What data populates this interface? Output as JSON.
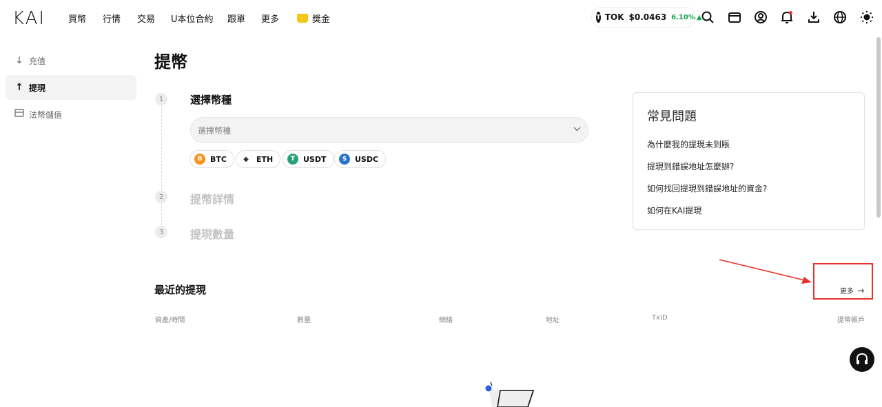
{
  "header": {
    "logo": "KAI",
    "nav": [
      "買幣",
      "行情",
      "交易",
      "U本位合約",
      "跟單",
      "更多"
    ],
    "rewards_label": "獎金",
    "ticker": {
      "symbol": "TOK",
      "price": "$0.0463",
      "change": "6.10%",
      "icon_letter": "T"
    }
  },
  "sidebar": {
    "items": [
      {
        "label": "充值",
        "icon": "arrow-down-icon",
        "active": false
      },
      {
        "label": "提現",
        "icon": "arrow-up-icon",
        "active": true
      },
      {
        "label": "法幣儲值",
        "icon": "card-icon",
        "active": false
      }
    ]
  },
  "main": {
    "title": "提幣",
    "steps": [
      {
        "num": "1",
        "title": "選擇幣種"
      },
      {
        "num": "2",
        "title": "提幣詳情"
      },
      {
        "num": "3",
        "title": "提現數量"
      }
    ],
    "select_placeholder": "選擇幣種",
    "coins": [
      {
        "symbol": "BTC",
        "color": "#f7931a",
        "glyph": "B"
      },
      {
        "symbol": "ETH",
        "color": "#555555",
        "glyph": "◆"
      },
      {
        "symbol": "USDT",
        "color": "#26a17b",
        "glyph": "T"
      },
      {
        "symbol": "USDC",
        "color": "#2775ca",
        "glyph": "$"
      }
    ]
  },
  "faq": {
    "title": "常見問題",
    "links": [
      "為什麼我的提現未到賬",
      "提現到錯誤地址怎麼辦?",
      "如何找回提現到錯誤地址的資金?",
      "如何在KAI提現"
    ]
  },
  "recent": {
    "title": "最近的提現",
    "more_label": "更多",
    "columns": [
      "資產/時間",
      "數量",
      "網絡",
      "地址",
      "TxID",
      "提幣帳戶"
    ]
  },
  "colors": {
    "accent_green": "#17a34a",
    "highlight_red": "#e8322b"
  }
}
